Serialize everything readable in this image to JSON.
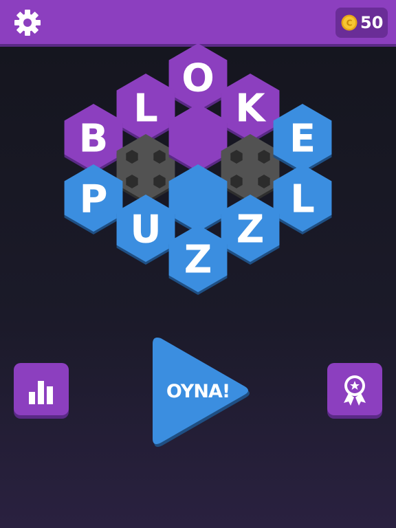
{
  "header": {
    "settings_icon": "gear-icon",
    "coin_icon": "coin-icon",
    "coin_symbol": "C",
    "coin_count": "50"
  },
  "board": {
    "colors": {
      "purple": "#8c3fbf",
      "blue": "#3b8ee0",
      "blocked": "#525252"
    },
    "tiles": [
      {
        "letter": "O",
        "color": "purple"
      },
      {
        "letter": "L",
        "color": "purple"
      },
      {
        "letter": "K",
        "color": "purple"
      },
      {
        "letter": "B",
        "color": "purple"
      },
      {
        "letter": "",
        "color": "blocked"
      },
      {
        "letter": "",
        "color": "purple"
      },
      {
        "letter": "",
        "color": "blocked"
      },
      {
        "letter": "E",
        "color": "blue"
      },
      {
        "letter": "P",
        "color": "blue"
      },
      {
        "letter": "",
        "color": "blue"
      },
      {
        "letter": "L",
        "color": "blue"
      },
      {
        "letter": "U",
        "color": "blue"
      },
      {
        "letter": "Z",
        "color": "blue"
      },
      {
        "letter": "Z",
        "color": "blue"
      }
    ]
  },
  "controls": {
    "stats_icon": "bar-chart-icon",
    "play_label": "OYNA!",
    "achievements_icon": "award-ribbon-icon"
  }
}
